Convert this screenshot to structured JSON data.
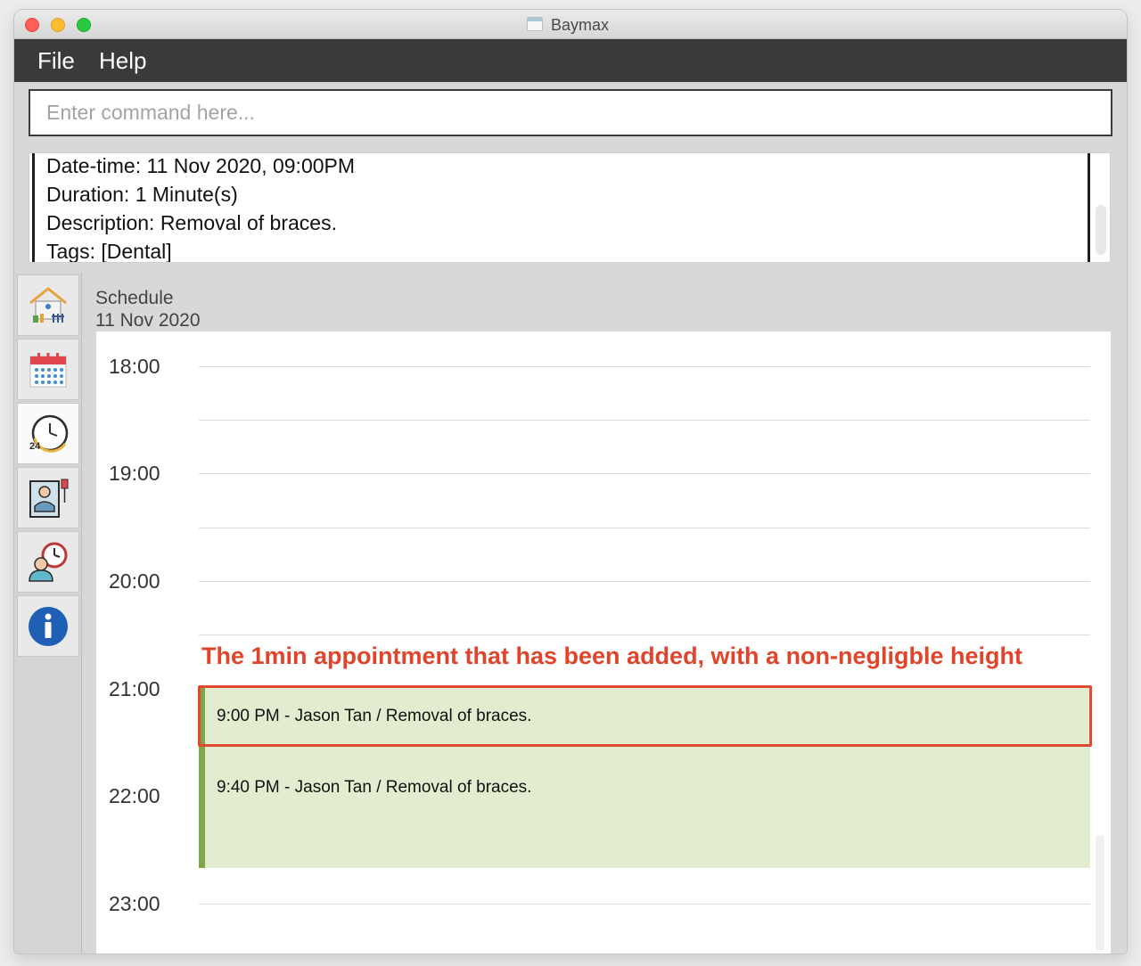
{
  "window": {
    "title": "Baymax",
    "colors": {
      "menubar": "#3a3a3a",
      "accent_green": "#7da84a",
      "appointment_fill": "#e2edcf",
      "annotation_red": "#e0452b"
    }
  },
  "menu": {
    "file": "File",
    "help": "Help"
  },
  "command": {
    "placeholder": "Enter command here...",
    "value": ""
  },
  "result": {
    "lines": [
      "Date-time: 11 Nov 2020, 09:00PM",
      "Duration: 1 Minute(s)",
      "Description: Removal of braces.",
      "Tags: [Dental]"
    ]
  },
  "sidebar": {
    "items": [
      {
        "icon": "home-icon"
      },
      {
        "icon": "calendar-icon"
      },
      {
        "icon": "clock-24h-icon",
        "active": true
      },
      {
        "icon": "patient-icon"
      },
      {
        "icon": "doctor-clock-icon"
      },
      {
        "icon": "info-icon"
      }
    ]
  },
  "schedule": {
    "label": "Schedule",
    "date": "11 Nov 2020",
    "hours": [
      "18:00",
      "19:00",
      "20:00",
      "21:00",
      "22:00",
      "23:00"
    ],
    "appointments": [
      {
        "text": "9:00 PM - Jason Tan / Removal of braces."
      },
      {
        "text": "9:40 PM - Jason Tan / Removal of braces."
      }
    ],
    "annotation": "The 1min appointment that has been added, with a non-negligble height"
  }
}
